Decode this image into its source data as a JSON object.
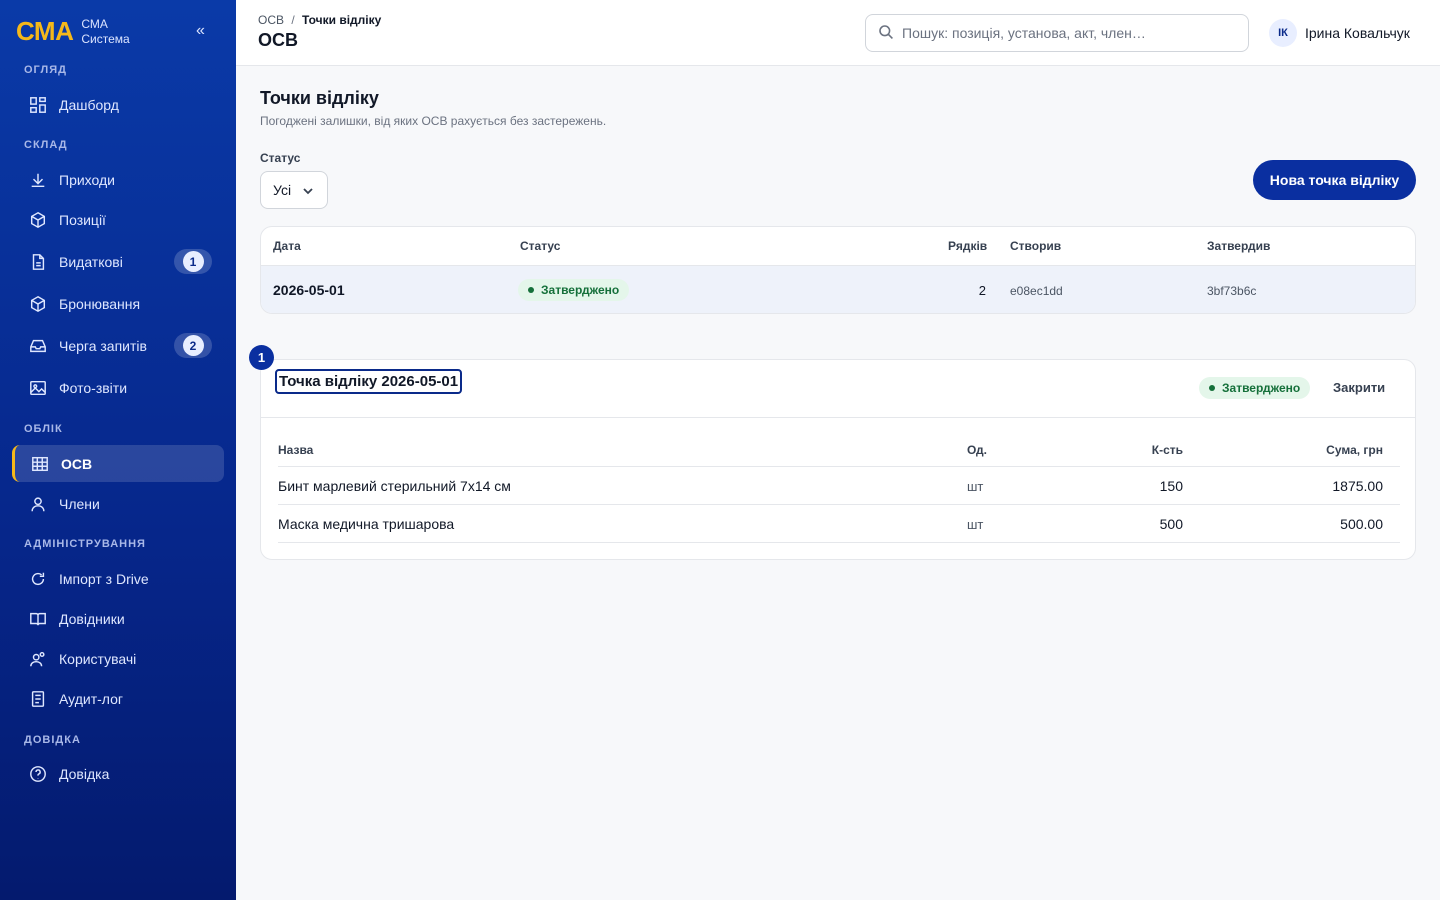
{
  "brand": {
    "logo": "СМА",
    "line1": "СМА",
    "line2": "Система",
    "collapse": "«"
  },
  "sidebar": {
    "sections": {
      "overview": "ОГЛЯД",
      "warehouse": "СКЛАД",
      "accounting": "ОБЛІК",
      "admin": "АДМІНІСТРУВАННЯ",
      "help": "ДОВІДКА"
    },
    "items": [
      {
        "label": "Дашборд",
        "icon": "dashboard-icon"
      },
      {
        "label": "Приходи",
        "icon": "download-icon"
      },
      {
        "label": "Позиції",
        "icon": "box-icon"
      },
      {
        "label": "Видаткові",
        "icon": "document-icon",
        "badge": "1"
      },
      {
        "label": "Бронювання",
        "icon": "box-icon"
      },
      {
        "label": "Черга запитів",
        "icon": "inbox-icon",
        "badge": "2"
      },
      {
        "label": "Фото-звіти",
        "icon": "image-icon"
      },
      {
        "label": "ОСВ",
        "icon": "table-icon",
        "active": true
      },
      {
        "label": "Члени",
        "icon": "user-icon"
      },
      {
        "label": "Імпорт з Drive",
        "icon": "refresh-icon"
      },
      {
        "label": "Довідники",
        "icon": "book-icon"
      },
      {
        "label": "Користувачі",
        "icon": "users-icon"
      },
      {
        "label": "Аудит-лог",
        "icon": "log-icon"
      },
      {
        "label": "Довідка",
        "icon": "help-icon"
      }
    ]
  },
  "topbar": {
    "breadcrumb": {
      "root": "ОСВ",
      "sep": "/",
      "current": "Точки відліку"
    },
    "title": "ОСВ",
    "search_placeholder": "Пошук: позиція, установа, акт, член…",
    "user": {
      "initials": "ІК",
      "name": "Ірина Ковальчук"
    }
  },
  "page": {
    "title": "Точки відліку",
    "subtitle": "Погоджені залишки, від яких ОСВ рахується без застережень.",
    "filter_label": "Статус",
    "filter_value": "Усі",
    "new_button": "Нова точка відліку"
  },
  "list": {
    "headers": {
      "date": "Дата",
      "status": "Статус",
      "rows": "Рядків",
      "created": "Створив",
      "approved": "Затвердив"
    },
    "rows": [
      {
        "date": "2026-05-01",
        "status": "Затверджено",
        "rows": "2",
        "created": "e08ec1dd",
        "approved": "3bf73b6c"
      }
    ]
  },
  "detail": {
    "marker": "1",
    "title": "Точка відліку 2026-05-01",
    "status": "Затверджено",
    "close": "Закрити",
    "headers": {
      "name": "Назва",
      "unit": "Од.",
      "qty": "К-сть",
      "sum": "Сума, грн"
    },
    "items": [
      {
        "name": "Бинт марлевий стерильний 7х14 см",
        "unit": "шт",
        "qty": "150",
        "sum": "1875.00"
      },
      {
        "name": "Маска медична тришарова",
        "unit": "шт",
        "qty": "500",
        "sum": "500.00"
      }
    ]
  },
  "colors": {
    "sidebar": "#0a3aa8",
    "accent": "#f5b81a",
    "primary": "#0a2fa0",
    "success": "#15703a"
  }
}
